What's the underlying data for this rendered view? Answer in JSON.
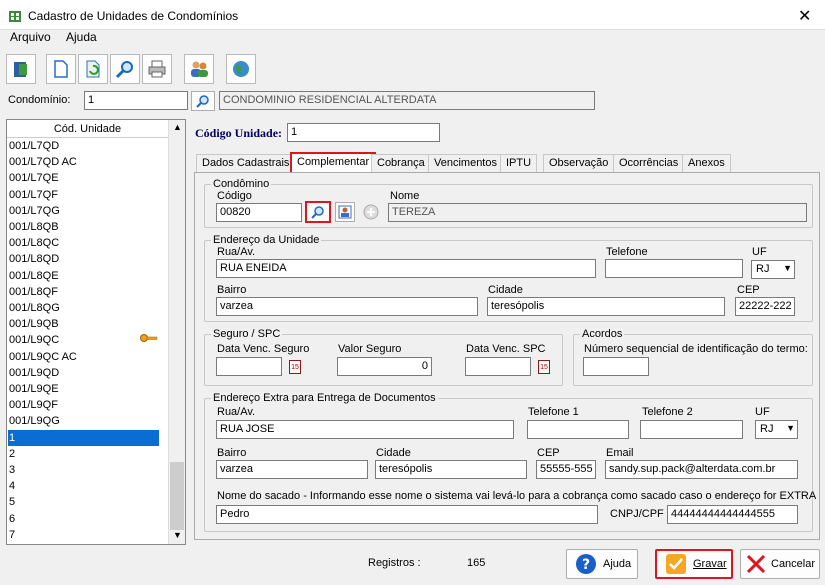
{
  "window": {
    "title": "Cadastro de Unidades de Condomínios"
  },
  "menu": {
    "file": "Arquivo",
    "help": "Ajuda"
  },
  "condominio": {
    "label": "Condomínio:",
    "code": "1",
    "name": "CONDOMINIO RESIDENCIAL ALTERDATA"
  },
  "list": {
    "header": "Cód. Unidade",
    "items": [
      "001/L7QD",
      "001/L7QD AC",
      "001/L7QE",
      "001/L7QF",
      "001/L7QG",
      "001/L8QB",
      "001/L8QC",
      "001/L8QD",
      "001/L8QE",
      "001/L8QF",
      "001/L8QG",
      "001/L9QB",
      "001/L9QC",
      "001/L9QC AC",
      "001/L9QD",
      "001/L9QE",
      "001/L9QF",
      "001/L9QG",
      "1",
      "2",
      "3",
      "4",
      "5",
      "6",
      "7"
    ],
    "selected_index": 18
  },
  "unit": {
    "label": "Código Unidade:",
    "value": "1"
  },
  "tabs": [
    "Dados Cadastrais",
    "Complementar",
    "Cobrança",
    "Vencimentos",
    "IPTU",
    "Observação",
    "Ocorrências",
    "Anexos"
  ],
  "condomino": {
    "legend": "Condômino",
    "code_label": "Código",
    "code": "00820",
    "name_label": "Nome",
    "name": "TEREZA"
  },
  "endereco": {
    "legend": "Endereço da Unidade",
    "street_label": "Rua/Av.",
    "street": "RUA ENEIDA",
    "phone_label": "Telefone",
    "phone": "",
    "uf_label": "UF",
    "uf": "RJ",
    "bairro_label": "Bairro",
    "bairro": "varzea",
    "city_label": "Cidade",
    "city": "teresópolis",
    "cep_label": "CEP",
    "cep": "22222-222"
  },
  "seguro": {
    "legend": "Seguro / SPC",
    "venc_label": "Data Venc. Seguro",
    "valor_label": "Valor Seguro",
    "valor": "0",
    "spc_label": "Data Venc. SPC",
    "cal": "15"
  },
  "acordos": {
    "legend": "Acordos",
    "label": "Número sequencial de identificação do termo:"
  },
  "extra": {
    "legend": "Endereço Extra para  Entrega de Documentos",
    "street_label": "Rua/Av.",
    "street": "RUA JOSE",
    "phone1_label": "Telefone 1",
    "phone2_label": "Telefone 2",
    "uf_label": "UF",
    "uf": "RJ",
    "bairro_label": "Bairro",
    "bairro": "varzea",
    "city_label": "Cidade",
    "city": "teresópolis",
    "cep_label": "CEP",
    "cep": "55555-555",
    "email_label": "Email",
    "email": "sandy.sup.pack@alterdata.com.br",
    "sacado_label": "Nome do sacado - Informando esse nome o sistema vai levá-lo para a cobrança como sacado caso o endereço for EXTRA",
    "sacado": "Pedro",
    "cnpj_label": "CNPJ/CPF",
    "cnpj": "44444444444444555"
  },
  "status": {
    "label": "Registros :",
    "count": "165"
  },
  "buttons": {
    "help": "Ajuda",
    "save": "Gravar",
    "cancel": "Cancelar"
  }
}
